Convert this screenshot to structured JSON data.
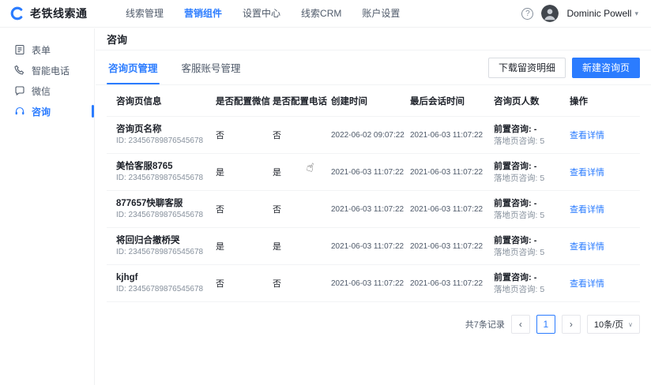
{
  "colors": {
    "primary": "#2b7cff",
    "text": "#1d2129",
    "muted": "#86909c",
    "border": "#f2f3f5"
  },
  "icons": {
    "help": "?",
    "user_caret": "▾",
    "select_caret": "∨",
    "prev": "‹",
    "next": "›",
    "cursor": "☝"
  },
  "header": {
    "logo_text": "老铁线索通",
    "nav": [
      {
        "label": "线索管理",
        "active": false
      },
      {
        "label": "营销组件",
        "active": true
      },
      {
        "label": "设置中心",
        "active": false
      },
      {
        "label": "线索CRM",
        "active": false
      },
      {
        "label": "账户设置",
        "active": false
      }
    ],
    "user_name": "Dominic Powell"
  },
  "sidebar": {
    "items": [
      {
        "label": "表单",
        "icon": "form-icon",
        "active": false
      },
      {
        "label": "智能电话",
        "icon": "phone-icon",
        "active": false
      },
      {
        "label": "微信",
        "icon": "wechat-icon",
        "active": false
      },
      {
        "label": "咨询",
        "icon": "consult-icon",
        "active": true
      }
    ]
  },
  "page": {
    "title": "咨询",
    "tabs": [
      {
        "label": "咨询页管理",
        "active": true
      },
      {
        "label": "客服账号管理",
        "active": false
      }
    ],
    "buttons": {
      "download": "下载留资明细",
      "create": "新建咨询页"
    }
  },
  "table": {
    "columns": [
      "咨询页信息",
      "是否配置微信",
      "是否配置电话",
      "创建时间",
      "最后会话时间",
      "咨询页人数",
      "操作"
    ],
    "rows": [
      {
        "name": "咨询页名称",
        "id": "ID: 23456789876545678",
        "wechat": "否",
        "phone": "否",
        "created": "2022-06-02 09:07:22",
        "last_session": "2021-06-03 11:07:22",
        "pre": "前置咨询: -",
        "landing": "落地页咨询: 5",
        "action": "查看详情"
      },
      {
        "name": "美恰客服8765",
        "id": "ID: 23456789876545678",
        "wechat": "是",
        "phone": "是",
        "created": "2021-06-03 11:07:22",
        "last_session": "2021-06-03 11:07:22",
        "pre": "前置咨询: -",
        "landing": "落地页咨询: 5",
        "action": "查看详情"
      },
      {
        "name": "877657快聊客服",
        "id": "ID: 23456789876545678",
        "wechat": "否",
        "phone": "否",
        "created": "2021-06-03 11:07:22",
        "last_session": "2021-06-03 11:07:22",
        "pre": "前置咨询: -",
        "landing": "落地页咨询: 5",
        "action": "查看详情"
      },
      {
        "name": "将回归合撤桥哭",
        "id": "ID: 23456789876545678",
        "wechat": "是",
        "phone": "是",
        "created": "2021-06-03 11:07:22",
        "last_session": "2021-06-03 11:07:22",
        "pre": "前置咨询: -",
        "landing": "落地页咨询: 5",
        "action": "查看详情"
      },
      {
        "name": "kjhgf",
        "id": "ID: 23456789876545678",
        "wechat": "否",
        "phone": "否",
        "created": "2021-06-03 11:07:22",
        "last_session": "2021-06-03 11:07:22",
        "pre": "前置咨询: -",
        "landing": "落地页咨询: 5",
        "action": "查看详情"
      }
    ]
  },
  "pagination": {
    "total": "共7条记录",
    "page": "1",
    "page_size": "10条/页"
  }
}
